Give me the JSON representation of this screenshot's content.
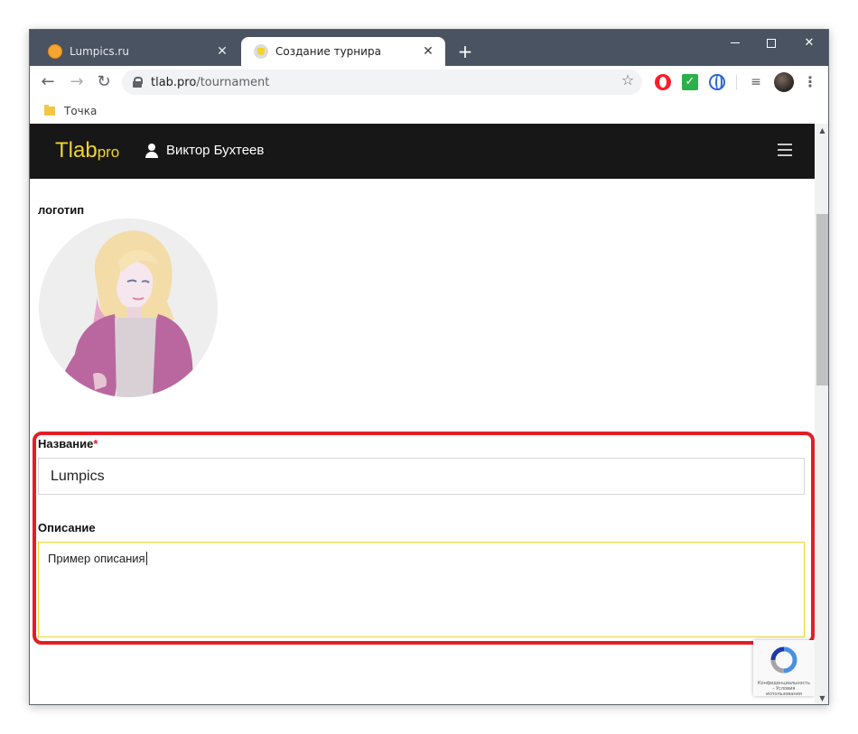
{
  "browser": {
    "tabs": [
      {
        "title": "Lumpics.ru",
        "active": false
      },
      {
        "title": "Создание турнира",
        "active": true
      }
    ],
    "url_host": "tlab.pro",
    "url_path": "/tournament",
    "bookmark": "Точка"
  },
  "site": {
    "brand": "Tlab",
    "brand_suffix": "pro",
    "brand_color": "#f2d42a",
    "user_name": "Виктор Бухтеев"
  },
  "form": {
    "logo_label": "логотип",
    "name_label": "Название",
    "name_required_mark": "*",
    "name_value": "Lumpics",
    "description_label": "Описание",
    "description_value": "Пример описания"
  },
  "recaptcha": {
    "text": "Конфиденциальность - Условия использования"
  },
  "colors": {
    "highlight": "#e31e24",
    "header_bg": "#171717",
    "tabstrip_bg": "#4a5361"
  }
}
